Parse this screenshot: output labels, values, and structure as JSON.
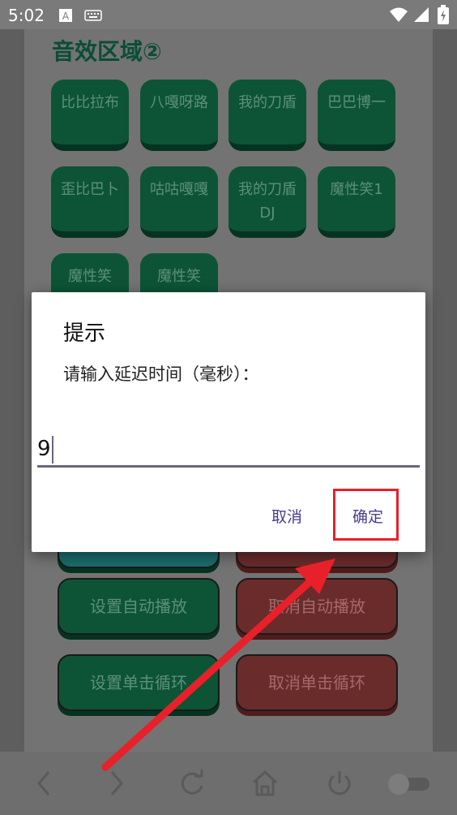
{
  "status": {
    "time": "5:02"
  },
  "section": {
    "title": "音效区域②"
  },
  "sound_buttons": [
    "比比拉布",
    "八嘎呀路",
    "我的刀盾",
    "巴巴博一",
    "歪比巴卜",
    "咕咕嘎嘎",
    "我的刀盾DJ",
    "魔性笑1",
    "魔性笑",
    "魔性笑"
  ],
  "controls": {
    "set_auto_play": "设置自动播放",
    "cancel_auto_play": "取消自动播放",
    "set_single_loop": "设置单击循环",
    "cancel_single_loop": "取消单击循环"
  },
  "dialog": {
    "title": "提示",
    "message": "请输入延迟时间（毫秒）：",
    "input_value": "9",
    "cancel": "取消",
    "confirm": "确定"
  },
  "colors": {
    "accent": "#4a3b8c",
    "highlight": "#e8202a"
  }
}
